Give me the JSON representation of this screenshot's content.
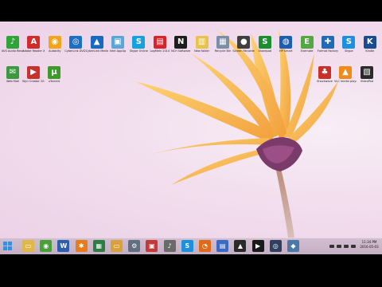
{
  "desktop": {
    "icons": [
      {
        "label": "AVS Audio Recorder",
        "color": "#2fa33a",
        "glyph": "♪"
      },
      {
        "label": "Adobe Reader XI",
        "color": "#d22b2b",
        "glyph": "A"
      },
      {
        "label": "Audacity",
        "color": "#f2a51a",
        "glyph": "◉"
      },
      {
        "label": "CyberLink DVD Suite",
        "color": "#1d6fc4",
        "glyph": "◎"
      },
      {
        "label": "CyberLink Media Suite",
        "color": "#1769c2",
        "glyph": "▲"
      },
      {
        "label": "Intel AppUp",
        "color": "#5aa6d8",
        "glyph": "▣"
      },
      {
        "label": "Skype Online",
        "color": "#15a0e0",
        "glyph": "S"
      },
      {
        "label": "LogMeIn 2014",
        "color": "#d8232a",
        "glyph": "▤"
      },
      {
        "label": "NCH Software",
        "color": "#1d1d1d",
        "glyph": "N"
      },
      {
        "label": "New folder",
        "color": "#e7c24d",
        "glyph": "▥"
      },
      {
        "label": "Recycle Bin",
        "color": "#7a8ea8",
        "glyph": "▦"
      },
      {
        "label": "Screen Recorder",
        "color": "#3f3f3f",
        "glyph": "●"
      },
      {
        "label": "Sharepod",
        "color": "#1a8f2f",
        "glyph": "S"
      },
      {
        "label": "HP Smart",
        "color": "#1a5fb4",
        "glyph": "◍"
      },
      {
        "label": "Evernote",
        "color": "#53a843",
        "glyph": "E"
      },
      {
        "label": "Format Factory",
        "color": "#1f6bb6",
        "glyph": "✚"
      },
      {
        "label": "Skype",
        "color": "#1b8fe0",
        "glyph": "S"
      },
      {
        "label": "Kindle",
        "color": "#1a4d8f",
        "glyph": "K"
      },
      {
        "label": "Web Mail",
        "color": "#3b9a3e",
        "glyph": "✉"
      },
      {
        "label": "Wyn Creator 2014",
        "color": "#c9322c",
        "glyph": "▶"
      },
      {
        "label": "uTorrent",
        "color": "#3d9a2b",
        "glyph": "µ"
      },
      {
        "label": "Shockwave",
        "color": "#c9302a",
        "glyph": "♣"
      },
      {
        "label": "VLC media player",
        "color": "#f08a18",
        "glyph": "▲"
      },
      {
        "label": "VideoPad",
        "color": "#2a2a2a",
        "glyph": "▧"
      }
    ]
  },
  "taskbar": {
    "items": [
      {
        "name": "file-explorer",
        "color": "#e0b84a",
        "glyph": "▭"
      },
      {
        "name": "chrome",
        "color": "#4a9f3a",
        "glyph": "◉"
      },
      {
        "name": "word",
        "color": "#2b5fb0",
        "glyph": "W"
      },
      {
        "name": "winamp",
        "color": "#e67c1a",
        "glyph": "✱"
      },
      {
        "name": "store",
        "color": "#2d7d46",
        "glyph": "▦"
      },
      {
        "name": "folder",
        "color": "#d9a13c",
        "glyph": "▭"
      },
      {
        "name": "settings",
        "color": "#607080",
        "glyph": "⚙"
      },
      {
        "name": "photos",
        "color": "#c43a3a",
        "glyph": "▣"
      },
      {
        "name": "itunes",
        "color": "#6a6a6a",
        "glyph": "♪"
      },
      {
        "name": "skype",
        "color": "#1b8fe0",
        "glyph": "S"
      },
      {
        "name": "firefox",
        "color": "#e06a1a",
        "glyph": "◔"
      },
      {
        "name": "control-panel",
        "color": "#3a6ac4",
        "glyph": "▤"
      },
      {
        "name": "graduation",
        "color": "#2a2a2a",
        "glyph": "▲"
      },
      {
        "name": "media-player",
        "color": "#1a1a1a",
        "glyph": "▶"
      },
      {
        "name": "steam",
        "color": "#2f3f5f",
        "glyph": "◎"
      },
      {
        "name": "tool",
        "color": "#4c7aa8",
        "glyph": "◆"
      }
    ]
  },
  "clock": {
    "time": "11:34 PM",
    "date": "2016-05-03"
  }
}
